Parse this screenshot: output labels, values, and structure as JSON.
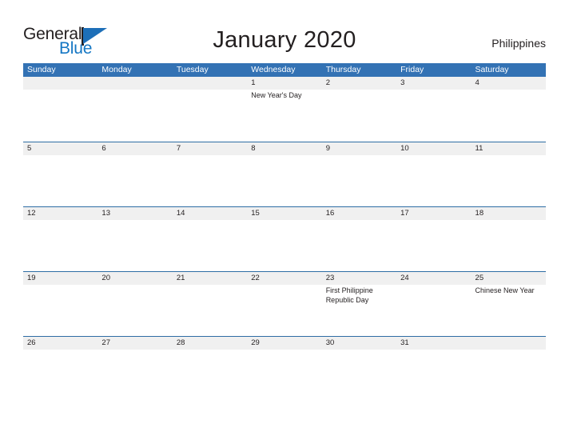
{
  "brand": {
    "name_part1": "General",
    "name_part2": "Blue",
    "flag_icon": "blue-flag-icon"
  },
  "header": {
    "title": "January 2020",
    "locale": "Philippines"
  },
  "colors": {
    "header_blue": "#3372b4",
    "row_rule_blue": "#2e6da4",
    "band_gray": "#f0f0f0",
    "logo_blue": "#1577c4",
    "text_dark": "#231f20"
  },
  "calendar": {
    "weekdays": [
      "Sunday",
      "Monday",
      "Tuesday",
      "Wednesday",
      "Thursday",
      "Friday",
      "Saturday"
    ],
    "weeks": [
      [
        {
          "day": "",
          "events": []
        },
        {
          "day": "",
          "events": []
        },
        {
          "day": "",
          "events": []
        },
        {
          "day": "1",
          "events": [
            "New Year's Day"
          ]
        },
        {
          "day": "2",
          "events": []
        },
        {
          "day": "3",
          "events": []
        },
        {
          "day": "4",
          "events": []
        }
      ],
      [
        {
          "day": "5",
          "events": []
        },
        {
          "day": "6",
          "events": []
        },
        {
          "day": "7",
          "events": []
        },
        {
          "day": "8",
          "events": []
        },
        {
          "day": "9",
          "events": []
        },
        {
          "day": "10",
          "events": []
        },
        {
          "day": "11",
          "events": []
        }
      ],
      [
        {
          "day": "12",
          "events": []
        },
        {
          "day": "13",
          "events": []
        },
        {
          "day": "14",
          "events": []
        },
        {
          "day": "15",
          "events": []
        },
        {
          "day": "16",
          "events": []
        },
        {
          "day": "17",
          "events": []
        },
        {
          "day": "18",
          "events": []
        }
      ],
      [
        {
          "day": "19",
          "events": []
        },
        {
          "day": "20",
          "events": []
        },
        {
          "day": "21",
          "events": []
        },
        {
          "day": "22",
          "events": []
        },
        {
          "day": "23",
          "events": [
            "First Philippine Republic Day"
          ]
        },
        {
          "day": "24",
          "events": []
        },
        {
          "day": "25",
          "events": [
            "Chinese New Year"
          ]
        }
      ],
      [
        {
          "day": "26",
          "events": []
        },
        {
          "day": "27",
          "events": []
        },
        {
          "day": "28",
          "events": []
        },
        {
          "day": "29",
          "events": []
        },
        {
          "day": "30",
          "events": []
        },
        {
          "day": "31",
          "events": []
        },
        {
          "day": "",
          "events": []
        }
      ]
    ]
  }
}
